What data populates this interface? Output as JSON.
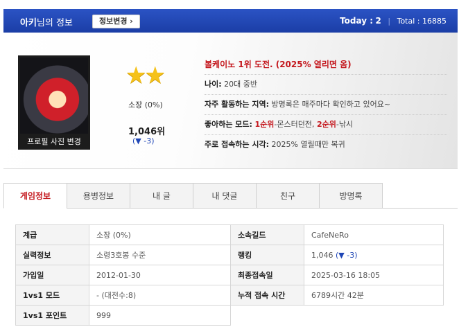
{
  "header": {
    "username": "아키",
    "suffix": "님의 정보",
    "edit_button": "정보변경 ›",
    "today_label": "Today :",
    "today_value": "2",
    "total_label": "Total :",
    "total_value": "16885"
  },
  "profile": {
    "photo_button": "프로필 사진 변경",
    "stars": "★★",
    "rank_label": "소장 (0%)",
    "rank_position": "1,046위",
    "rank_change": "(▼ -3)",
    "headline": "볼케이노 1위 도전. (2025% 열리면 옴)",
    "age_label": "나이:",
    "age_value": "20대 중반",
    "area_label": "자주 활동하는 지역:",
    "area_value": "방명록은 매주마다 확인하고 있어요~",
    "mode_label": "좋아하는 모드:",
    "mode_1_rank": "1순위",
    "mode_1_value": "-몬스터던전,",
    "mode_2_rank": "2순위",
    "mode_2_value": "-낚시",
    "time_label": "주로 접속하는 시각:",
    "time_value": "2025% 열릴때만 복귀"
  },
  "tabs": [
    "게임정보",
    "용병정보",
    "내 글",
    "내 댓글",
    "친구",
    "방명록"
  ],
  "table": {
    "rows": [
      {
        "k1": "계급",
        "v1": "소장 (0%)",
        "k2": "소속길드",
        "v2": "CafeNeRo"
      },
      {
        "k1": "실력정보",
        "v1": "소령3호봉 수준",
        "k2": "랭킹",
        "v2": "1,046",
        "v2_extra": "(▼ -3)"
      },
      {
        "k1": "가입일",
        "v1": "2012-01-30",
        "k2": "최종접속일",
        "v2": "2025-03-16 18:05"
      },
      {
        "k1": "1vs1 모드",
        "v1": "- (대전수:8)",
        "k2": "누적 접속 시간",
        "v2": "6789시간 42분"
      },
      {
        "k1": "1vs1 포인트",
        "v1": "999"
      }
    ]
  }
}
